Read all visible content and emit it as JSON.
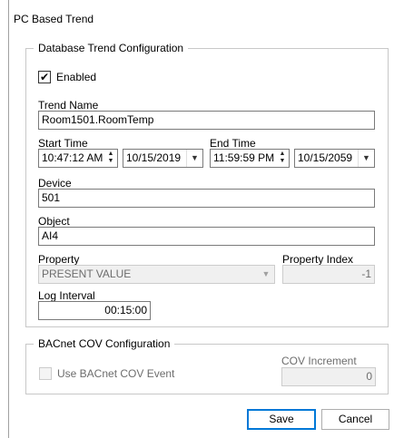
{
  "window": {
    "title": "PC Based Trend"
  },
  "db_group": {
    "legend": "Database Trend Configuration",
    "enabled_label": "Enabled",
    "enabled_checked": true,
    "trend_name_label": "Trend Name",
    "trend_name_value": "Room1501.RoomTemp",
    "start_time_label": "Start Time",
    "start_time_value": "10:47:12 AM",
    "start_date_value": "10/15/2019",
    "end_time_label": "End Time",
    "end_time_value": "11:59:59 PM",
    "end_date_value": "10/15/2059",
    "device_label": "Device",
    "device_value": "501",
    "object_label": "Object",
    "object_value": "AI4",
    "property_label": "Property",
    "property_value": "PRESENT VALUE",
    "property_index_label": "Property Index",
    "property_index_value": "-1",
    "log_interval_label": "Log Interval",
    "log_interval_value": "00:15:00"
  },
  "cov_group": {
    "legend": "BACnet COV Configuration",
    "use_cov_label": "Use BACnet COV Event",
    "use_cov_checked": false,
    "cov_increment_label": "COV Increment",
    "cov_increment_value": "0"
  },
  "buttons": {
    "save": "Save",
    "cancel": "Cancel"
  },
  "icons": {
    "check": "checkmark-icon",
    "spin_up": "spin-up-icon",
    "spin_down": "spin-down-icon",
    "dropdown": "chevron-down-icon"
  },
  "colors": {
    "accent": "#0078d7",
    "disabled_bg": "#f0f0f0",
    "border": "#7a7a7a"
  }
}
